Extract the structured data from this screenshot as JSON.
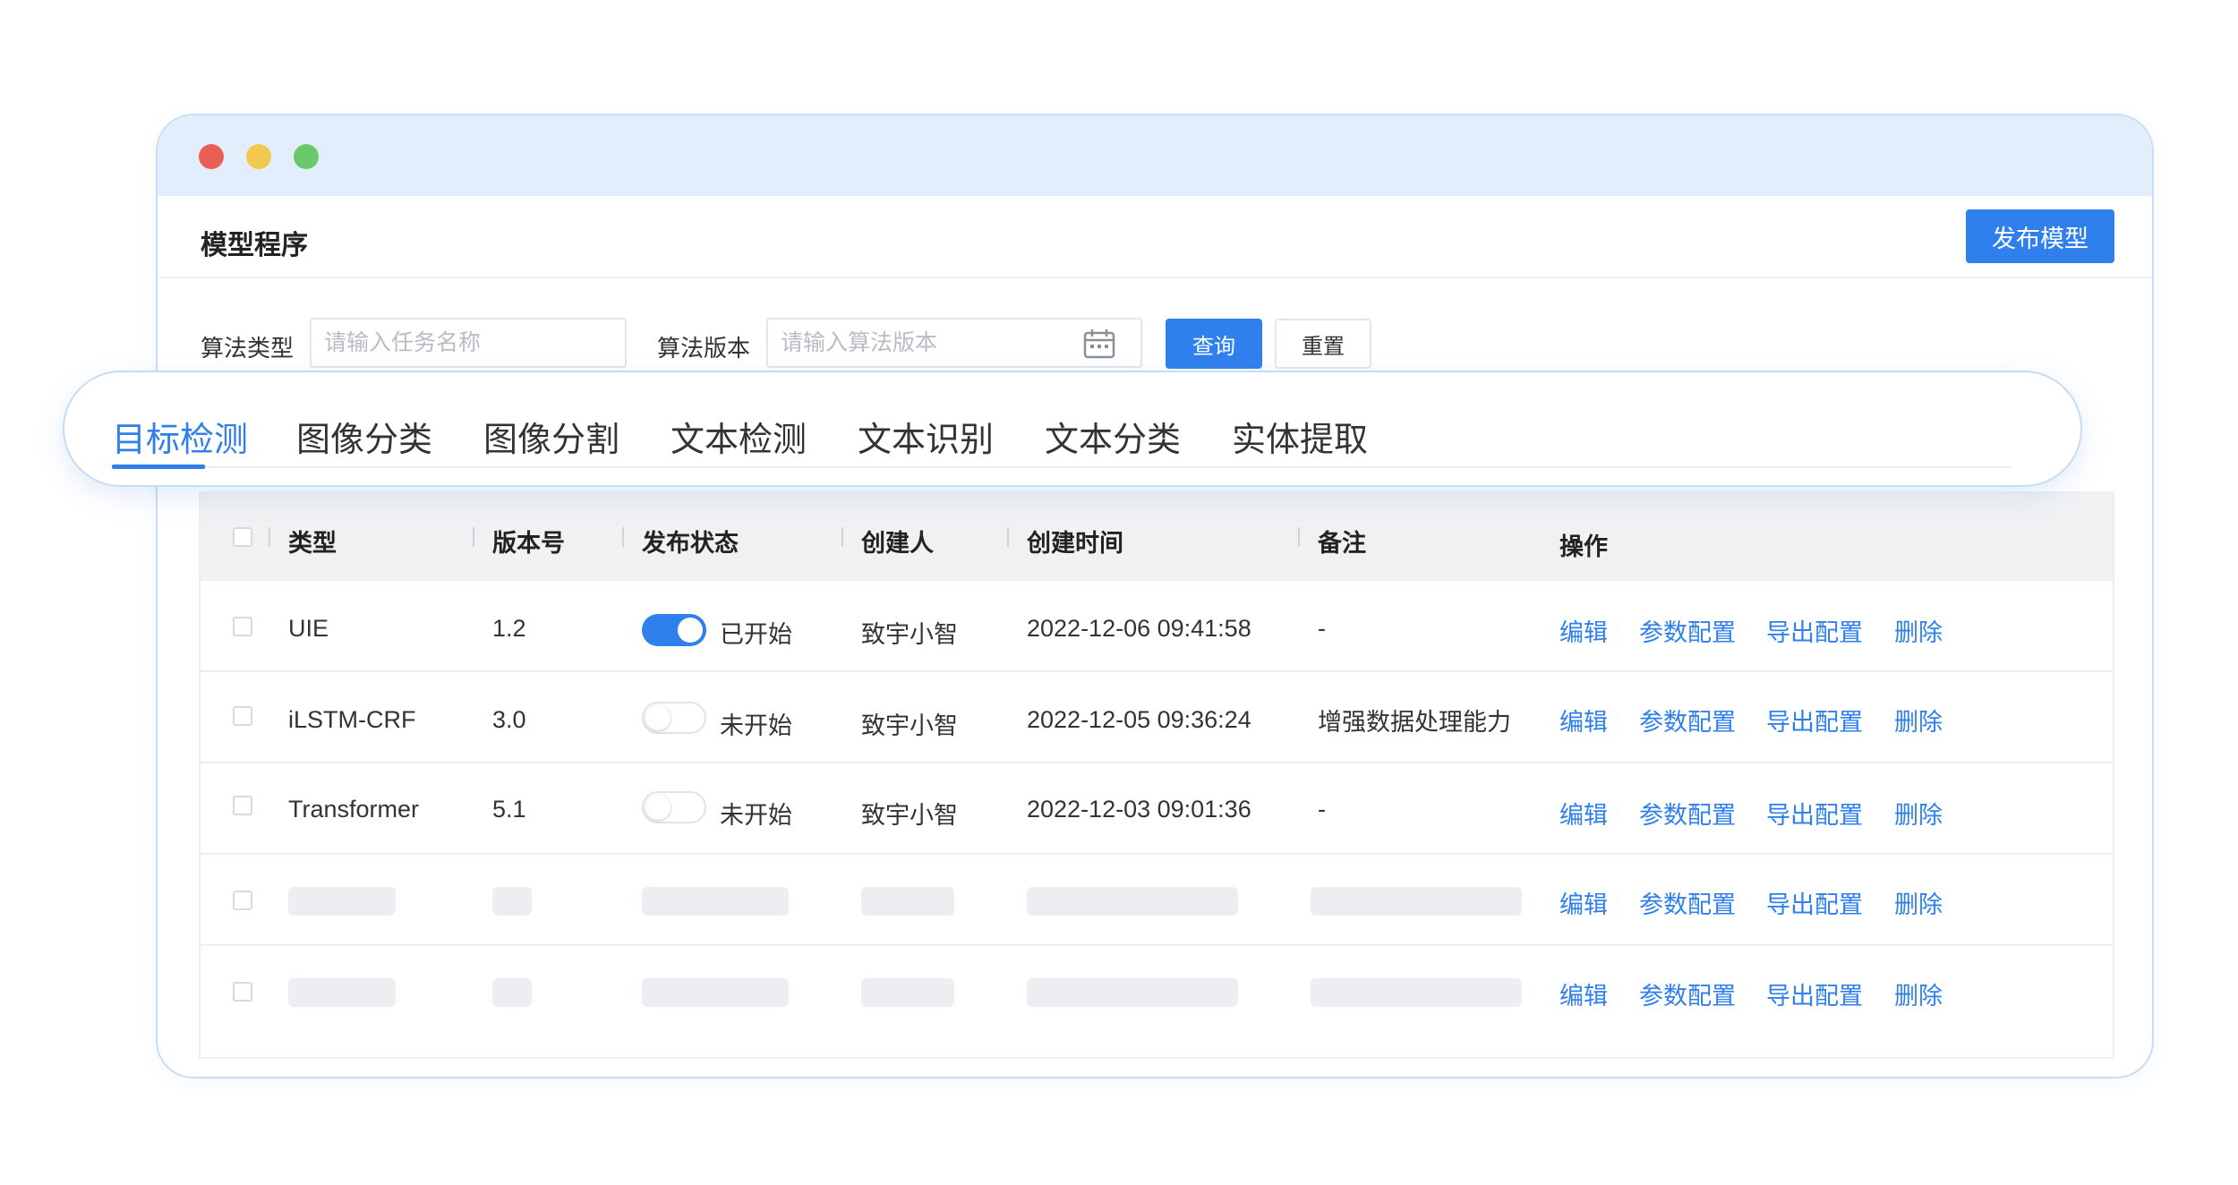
{
  "header": {
    "title": "模型程序",
    "publish_label": "发布模型"
  },
  "filters": {
    "algo_type_label": "算法类型",
    "algo_type_placeholder": "请输入任务名称",
    "algo_version_label": "算法版本",
    "algo_version_placeholder": "请输入算法版本",
    "query_label": "查询",
    "reset_label": "重置"
  },
  "tabs": [
    "目标检测",
    "图像分类",
    "图像分割",
    "文本检测",
    "文本识别",
    "文本分类",
    "实体提取"
  ],
  "table": {
    "headers": [
      "类型",
      "版本号",
      "发布状态",
      "创建人",
      "创建时间",
      "备注",
      "操作"
    ],
    "actions": [
      "编辑",
      "参数配置",
      "导出配置",
      "删除"
    ],
    "rows": [
      {
        "type": "UIE",
        "version": "1.2",
        "status_on": true,
        "status": "已开始",
        "creator": "致宇小智",
        "created": "2022-12-06  09:41:58",
        "note": "-"
      },
      {
        "type": "iLSTM-CRF",
        "version": "3.0",
        "status_on": false,
        "status": "未开始",
        "creator": "致宇小智",
        "created": "2022-12-05  09:36:24",
        "note": "增强数据处理能力"
      },
      {
        "type": "Transformer",
        "version": "5.1",
        "status_on": false,
        "status": "未开始",
        "creator": "致宇小智",
        "created": "2022-12-03  09:01:36",
        "note": "-"
      }
    ]
  },
  "colors": {
    "accent": "#2f80ed",
    "titlebar": "#e3eefc",
    "border": "#c9ddf6"
  },
  "icons": [
    "calendar-icon"
  ]
}
